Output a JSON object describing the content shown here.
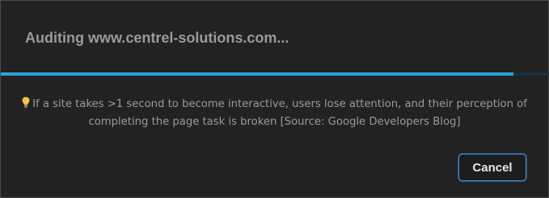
{
  "dialog": {
    "title": "Auditing www.centrel-solutions.com...",
    "progress": 0.933,
    "tip_icon": "lightbulb-icon",
    "tip_text": "If a site takes >1 second to become interactive, users lose attention, and their perception of completing the page task is broken [Source: Google Developers Blog]",
    "cancel_label": "Cancel"
  },
  "colors": {
    "background": "#222222",
    "accent": "#2aa2de",
    "text_muted": "#9a9a9a",
    "button_border": "#4a8fc9"
  }
}
